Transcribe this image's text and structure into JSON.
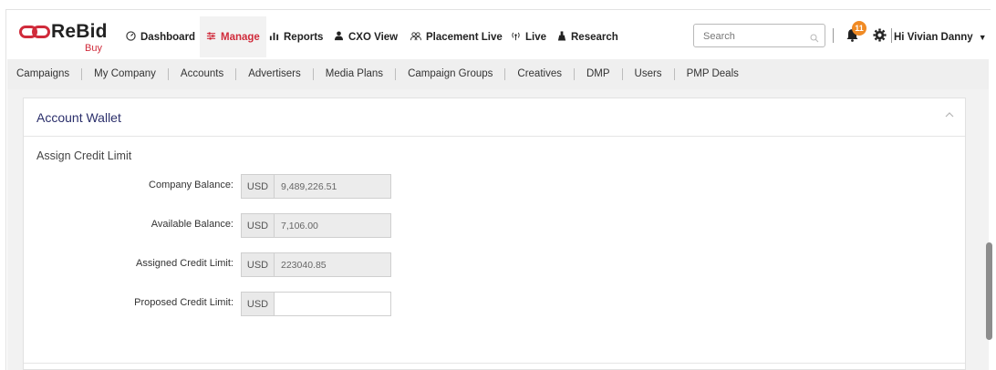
{
  "brand": {
    "name": "ReBid",
    "sub": "Buy",
    "color": "#d02b3b"
  },
  "nav": {
    "items": [
      {
        "label": "Dashboard",
        "icon": "speedometer-icon"
      },
      {
        "label": "Manage",
        "icon": "sliders-icon",
        "active": true
      },
      {
        "label": "Reports",
        "icon": "bar-chart-icon"
      },
      {
        "label": "CXO View",
        "icon": "person-icon"
      },
      {
        "label": "Placement Live",
        "icon": "people-icon"
      },
      {
        "label": "Live",
        "icon": "broadcast-icon"
      },
      {
        "label": "Research",
        "icon": "flask-icon"
      }
    ]
  },
  "search": {
    "placeholder": "Search"
  },
  "notifications": {
    "count": "11"
  },
  "user": {
    "greeting": "Hi Vivian Danny"
  },
  "subnav": {
    "items": [
      "Campaigns",
      "My Company",
      "Accounts",
      "Advertisers",
      "Media Plans",
      "Campaign Groups",
      "Creatives",
      "DMP",
      "Users",
      "PMP Deals"
    ]
  },
  "card": {
    "title": "Account Wallet",
    "section": "Assign Credit Limit",
    "fields": [
      {
        "label": "Company Balance:",
        "currency": "USD",
        "value": "9,489,226.51"
      },
      {
        "label": "Available Balance:",
        "currency": "USD",
        "value": "7,106.00"
      },
      {
        "label": "Assigned Credit Limit:",
        "currency": "USD",
        "value": "223040.85"
      },
      {
        "label": "Proposed Credit Limit:",
        "currency": "USD",
        "value": ""
      }
    ]
  }
}
